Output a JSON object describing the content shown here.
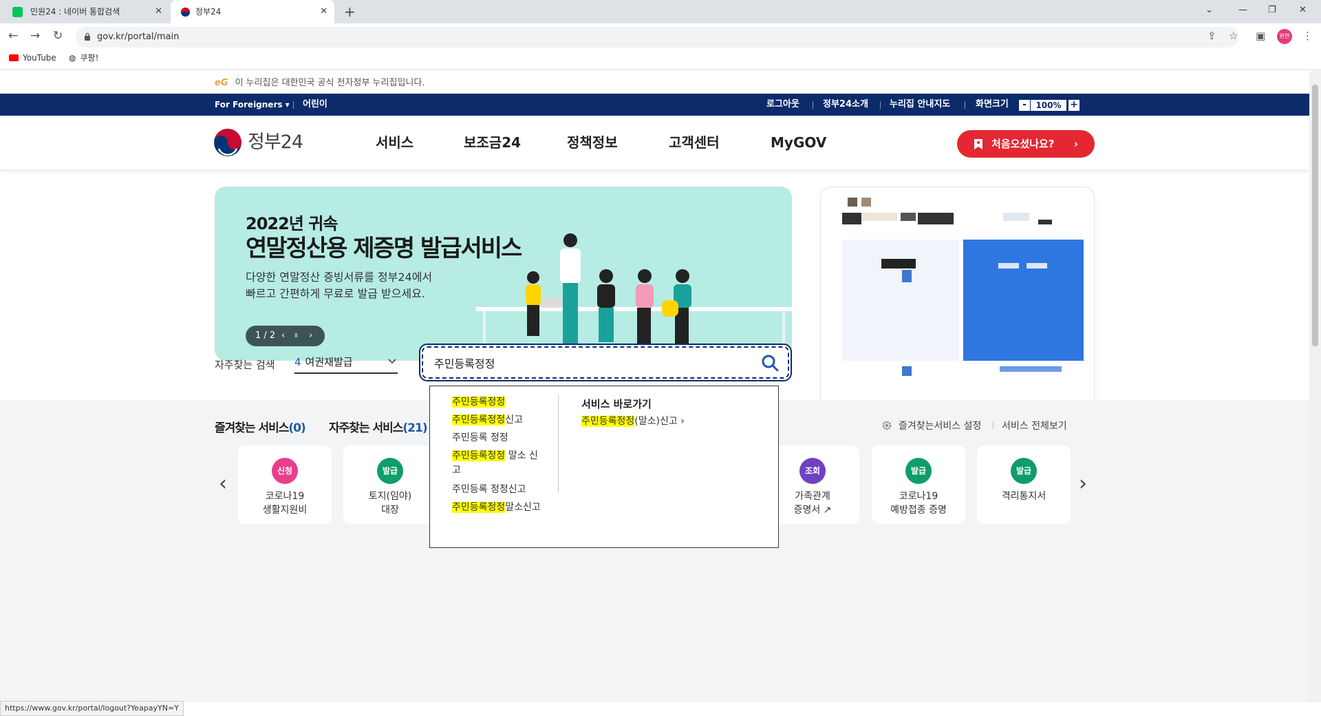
{
  "browser": {
    "tabs": [
      {
        "title": "민원24 : 네이버 통합검색",
        "active": false
      },
      {
        "title": "정부24",
        "active": true
      }
    ],
    "url": "gov.kr/portal/main",
    "bookmarks": [
      "YouTube",
      "쿠팡!"
    ],
    "profile_label": "완연",
    "status_url": "https://www.gov.kr/portal/logout?YeapayYN=Y"
  },
  "notice": {
    "prefix": "eG",
    "text": "이 누리집은 대한민국 공식 전자정부 누리집입니다."
  },
  "utility": {
    "left": [
      "For Foreigners ▾",
      "어린이"
    ],
    "right": [
      "로그아웃",
      "정부24소개",
      "누리집 안내지도",
      "화면크기"
    ],
    "zoom_minus": "-",
    "zoom_value": "100%",
    "zoom_plus": "+"
  },
  "header": {
    "logo": "정부24",
    "menu": [
      "서비스",
      "보조금24",
      "정책정보",
      "고객센터",
      "MyGOV"
    ],
    "first_visit": "처음오셨나요?",
    "first_visit_arrow": "›"
  },
  "banner": {
    "year": "2022년 귀속",
    "title": "연말정산용 제증명 발급서비스",
    "desc1": "다양한 연말정산 증빙서류를 정부24에서",
    "desc2": "빠르고 간편하게 무료로 발급 받으세요.",
    "page": "1 / 2",
    "prev": "‹",
    "pause": "॥",
    "next": "›"
  },
  "search": {
    "label": "자주찾는 검색",
    "rank": "4",
    "keyword": "여권재발급",
    "value": "주민등록정정"
  },
  "suggestions": {
    "items": [
      {
        "hl": "주민등록정정",
        "rest": ""
      },
      {
        "hl": "주민등록정정",
        "rest": "신고"
      },
      {
        "hl": "",
        "rest": "주민등록 정정"
      },
      {
        "hl": "주민등록정정",
        "rest": " 말소 신"
      },
      {
        "hl": "",
        "rest": "고"
      },
      {
        "hl": "",
        "rest": "주민등록 정정신고"
      },
      {
        "hl": "주민등록정정",
        "rest": "말소신고"
      }
    ],
    "shortcut_title": "서비스 바로가기",
    "shortcut_hl": "주민등록정정",
    "shortcut_rest": "(말소)신고",
    "shortcut_arrow": "›"
  },
  "services": {
    "fav_label": "즐겨찾는 서비스",
    "fav_count": "(0)",
    "freq_label": "자주찾는 서비스",
    "freq_count": "(21)",
    "settings": "즐겨찾는서비스 설정",
    "all": "서비스 전체보기",
    "prev": "‹",
    "next": "›",
    "cards": [
      {
        "badge": "신청",
        "color": "#e83e8c",
        "line1": "코로나19",
        "line2": "생활지원비"
      },
      {
        "badge": "발급",
        "color": "#0f9d6a",
        "line1": "토지(임야)",
        "line2": "대장"
      },
      {
        "badge": "조회",
        "color": "#6f42c1",
        "line1": "가족관계",
        "line2": "증명서 ↗"
      },
      {
        "badge": "발급",
        "color": "#0f9d6a",
        "line1": "코로나19",
        "line2": "예방접종 증명"
      },
      {
        "badge": "발급",
        "color": "#0f9d6a",
        "line1": "격리통지서",
        "line2": ""
      }
    ]
  },
  "colors": {
    "navy": "#0b2b6b",
    "red": "#e42732",
    "highlight": "#ffff00",
    "banner_bg": "#b6ece3"
  }
}
